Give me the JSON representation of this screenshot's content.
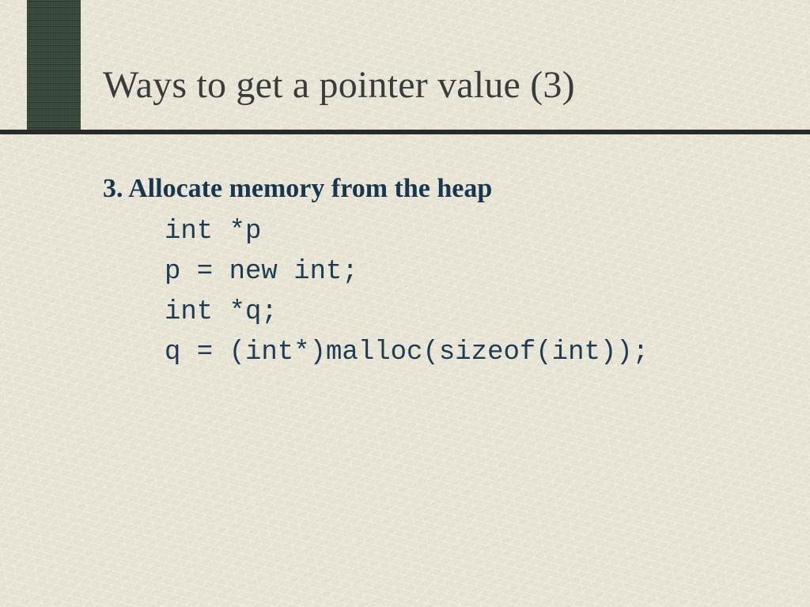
{
  "slide": {
    "title": "Ways to get a pointer value (3)",
    "heading": "3. Allocate memory from the heap",
    "code_lines": {
      "l1": "int *p",
      "l2": "p = new int;",
      "l3": "int *q;",
      "l4": "q = (int*)malloc(sizeof(int));"
    }
  }
}
